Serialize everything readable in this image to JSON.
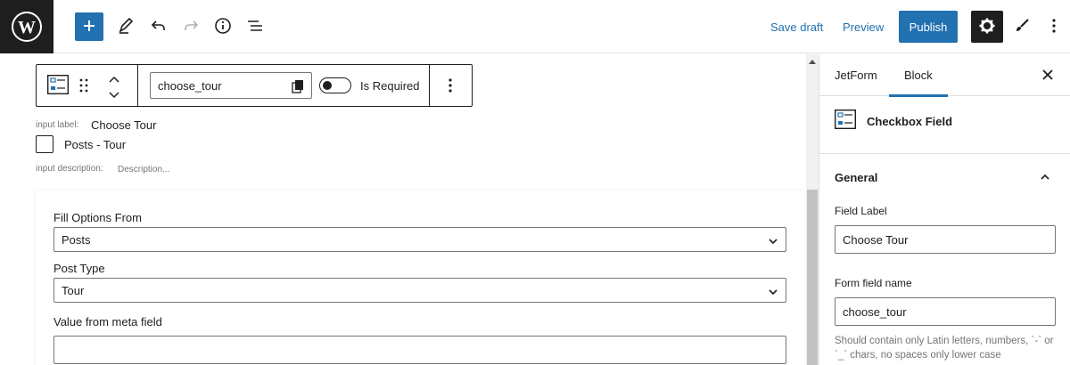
{
  "topbar": {
    "save_draft": "Save draft",
    "preview": "Preview",
    "publish": "Publish",
    "icons": [
      "wordpress-icon",
      "plus-icon",
      "pencil-icon",
      "undo-icon",
      "redo-icon",
      "info-icon",
      "list-view-icon",
      "gear-icon",
      "brush-icon",
      "more-vertical-icon"
    ],
    "accent": "#2271b1"
  },
  "block_toolbar": {
    "field_name_value": "choose_tour",
    "required_label": "Is Required"
  },
  "field": {
    "input_label_caption": "input label:",
    "input_label_value": "Choose Tour",
    "option_label": "Posts - Tour",
    "description_caption": "input description:",
    "description_placeholder": "Description..."
  },
  "panel": {
    "fill_options_label": "Fill Options From",
    "fill_options_value": "Posts",
    "post_type_label": "Post Type",
    "post_type_value": "Tour",
    "meta_field_label": "Value from meta field",
    "meta_field_value": ""
  },
  "sidebar": {
    "tabs": [
      "JetForm",
      "Block"
    ],
    "active_tab": "Block",
    "block_name": "Checkbox Field",
    "section_title": "General",
    "field_label_caption": "Field Label",
    "field_label_value": "Choose Tour",
    "form_field_name_caption": "Form field name",
    "form_field_name_value": "choose_tour",
    "help_text": "Should contain only Latin letters, numbers, `-` or `_` chars, no spaces only lower case"
  }
}
